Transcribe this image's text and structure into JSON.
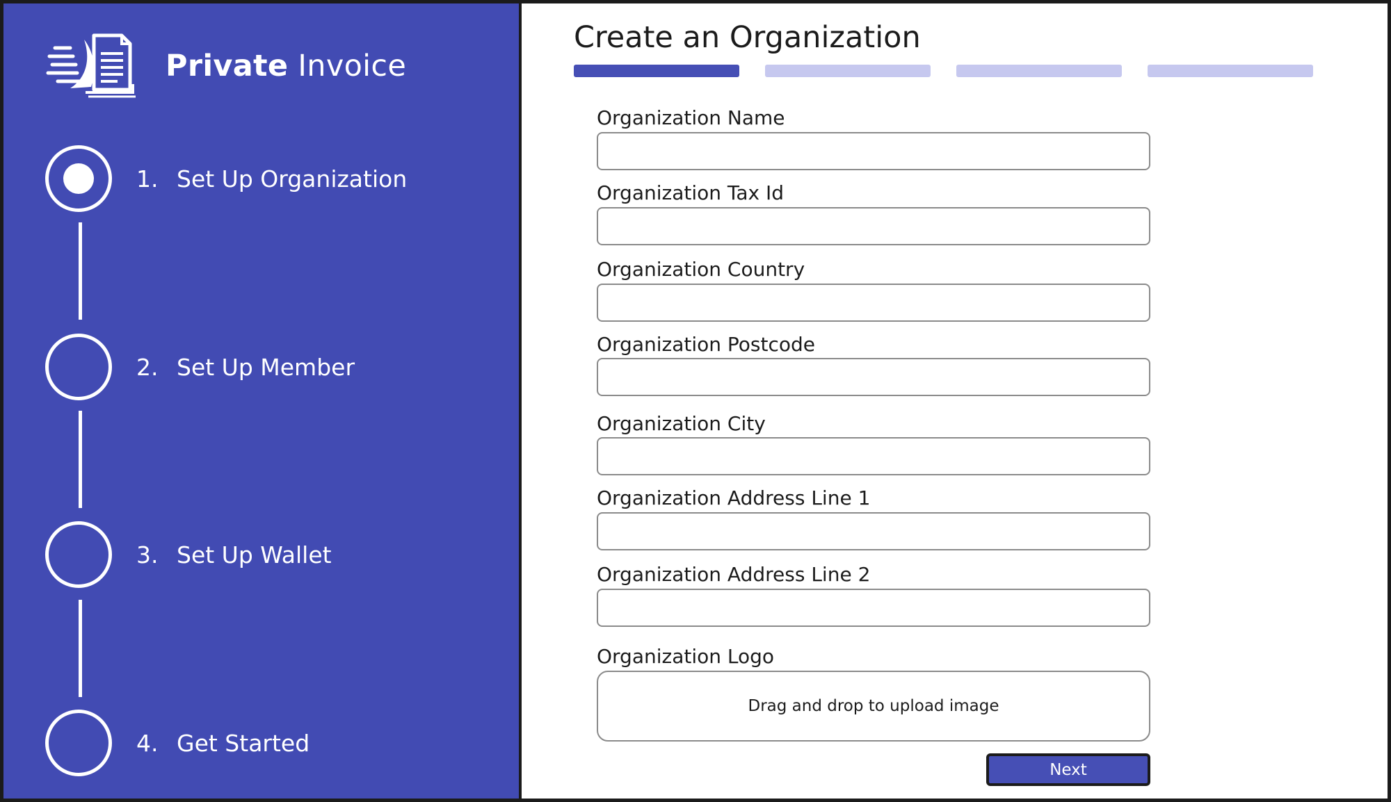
{
  "app": {
    "name_bold": "Private",
    "name_regular": " Invoice"
  },
  "steps": [
    {
      "number": "1.",
      "label": "Set Up Organization",
      "state": "active"
    },
    {
      "number": "2.",
      "label": "Set Up Member",
      "state": "inactive"
    },
    {
      "number": "3.",
      "label": "Set Up Wallet",
      "state": "inactive"
    },
    {
      "number": "4.",
      "label": "Get Started",
      "state": "inactive"
    }
  ],
  "form": {
    "title": "Create an Organization",
    "progress": {
      "current_step": 1,
      "total_steps": 4
    },
    "fields": [
      {
        "label": "Organization Name",
        "value": ""
      },
      {
        "label": "Organization Tax Id",
        "value": ""
      },
      {
        "label": "Organization Country",
        "value": ""
      },
      {
        "label": "Organization Postcode",
        "value": ""
      },
      {
        "label": "Organization City",
        "value": ""
      },
      {
        "label": "Organization Address Line 1",
        "value": ""
      },
      {
        "label": "Organization Address Line 2",
        "value": ""
      }
    ],
    "logo": {
      "label": "Organization Logo",
      "dropzone_text": "Drag and drop to upload image"
    },
    "next_label": "Next"
  },
  "colors": {
    "sidebar_bg": "#424bb3",
    "accent": "#464fb5",
    "progress_inactive": "#c6c8ef"
  },
  "icons": {
    "brand": "invoice-document-icon"
  }
}
